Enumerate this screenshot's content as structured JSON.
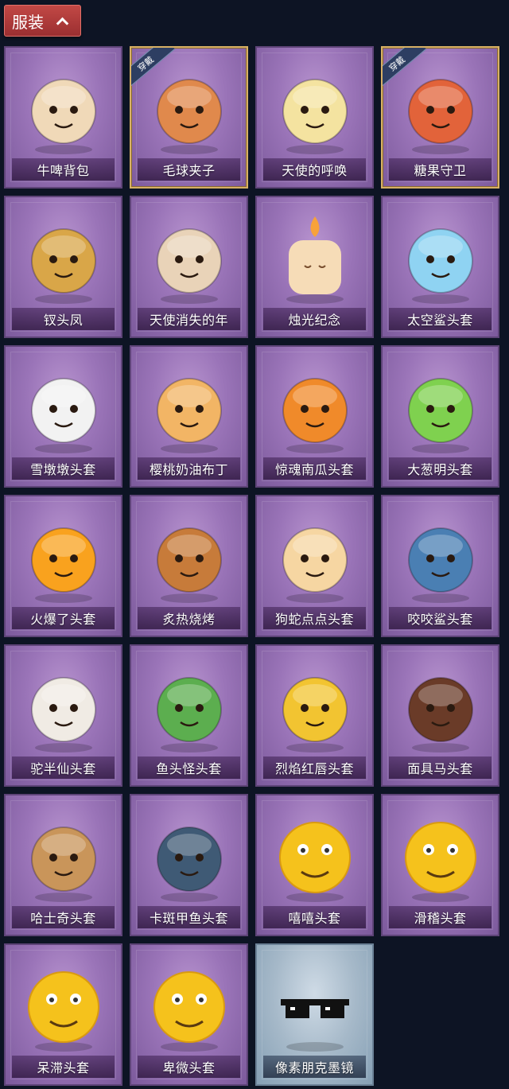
{
  "header": {
    "tab_label": "服装"
  },
  "equipped_badge": "穿戴",
  "items": [
    {
      "label": "牛啤背包",
      "icon": "cow-beer-barrel-icon",
      "equipped": false,
      "special": false,
      "color": "#f0d9b8"
    },
    {
      "label": "毛球夹子",
      "icon": "raccoon-drummer-icon",
      "equipped": true,
      "special": false,
      "color": "#e0894c"
    },
    {
      "label": "天使的呼唤",
      "icon": "angel-doll-icon",
      "equipped": false,
      "special": false,
      "color": "#f4e3a0"
    },
    {
      "label": "糖果守卫",
      "icon": "pumpkin-scarecrow-icon",
      "equipped": true,
      "special": false,
      "color": "#e2633a"
    },
    {
      "label": "钗头凤",
      "icon": "phoenix-crown-girl-icon",
      "equipped": false,
      "special": false,
      "color": "#d9a648"
    },
    {
      "label": "天使消失的年",
      "icon": "angel-girl-veil-icon",
      "equipped": false,
      "special": false,
      "color": "#e9d3b8"
    },
    {
      "label": "烛光纪念",
      "icon": "candle-face-icon",
      "equipped": false,
      "special": false,
      "color": "#f6dcb7"
    },
    {
      "label": "太空鲨头套",
      "icon": "space-shark-icon",
      "equipped": false,
      "special": false,
      "color": "#8fd3f2"
    },
    {
      "label": "雪墩墩头套",
      "icon": "snowman-hat-icon",
      "equipped": false,
      "special": false,
      "color": "#f2f2f2"
    },
    {
      "label": "樱桃奶油布丁",
      "icon": "cherry-pudding-icon",
      "equipped": false,
      "special": false,
      "color": "#f2b565"
    },
    {
      "label": "惊魂南瓜头套",
      "icon": "jack-o-lantern-icon",
      "equipped": false,
      "special": false,
      "color": "#f08a2a"
    },
    {
      "label": "大葱明头套",
      "icon": "green-onion-icon",
      "equipped": false,
      "special": false,
      "color": "#7fd14f"
    },
    {
      "label": "火爆了头套",
      "icon": "fire-face-icon",
      "equipped": false,
      "special": false,
      "color": "#f9a21e"
    },
    {
      "label": "炙热烧烤",
      "icon": "roast-meat-icon",
      "equipped": false,
      "special": false,
      "color": "#c77b3a"
    },
    {
      "label": "狗蛇点点头套",
      "icon": "snake-dog-icon",
      "equipped": false,
      "special": false,
      "color": "#f6d6a2"
    },
    {
      "label": "咬咬鲨头套",
      "icon": "biting-shark-icon",
      "equipped": false,
      "special": false,
      "color": "#4a7fb3"
    },
    {
      "label": "驼半仙头套",
      "icon": "alpaca-sunglasses-icon",
      "equipped": false,
      "special": false,
      "color": "#f0ebe4"
    },
    {
      "label": "鱼头怪头套",
      "icon": "fish-head-monster-icon",
      "equipped": false,
      "special": false,
      "color": "#5cae4f"
    },
    {
      "label": "烈焰红唇头套",
      "icon": "yellow-mask-sunglasses-icon",
      "equipped": false,
      "special": false,
      "color": "#f2c431"
    },
    {
      "label": "面具马头套",
      "icon": "horse-mask-icon",
      "equipped": false,
      "special": false,
      "color": "#6a3b28"
    },
    {
      "label": "哈士奇头套",
      "icon": "husky-sunglasses-icon",
      "equipped": false,
      "special": false,
      "color": "#c9955a"
    },
    {
      "label": "卡斑甲鱼头套",
      "icon": "whale-head-icon",
      "equipped": false,
      "special": false,
      "color": "#3f5a75"
    },
    {
      "label": "嘻嘻头套",
      "icon": "grin-emoji-icon",
      "equipped": false,
      "special": false,
      "color": "#f5c21c"
    },
    {
      "label": "滑稽头套",
      "icon": "funny-emoji-icon",
      "equipped": false,
      "special": false,
      "color": "#f5c21c"
    },
    {
      "label": "呆滞头套",
      "icon": "dazed-emoji-icon",
      "equipped": false,
      "special": false,
      "color": "#f5c21c"
    },
    {
      "label": "卑微头套",
      "icon": "humble-emoji-icon",
      "equipped": false,
      "special": false,
      "color": "#f5c21c"
    },
    {
      "label": "像素朋克墨镜",
      "icon": "pixel-sunglasses-icon",
      "equipped": false,
      "special": true,
      "color": "#111111"
    }
  ]
}
